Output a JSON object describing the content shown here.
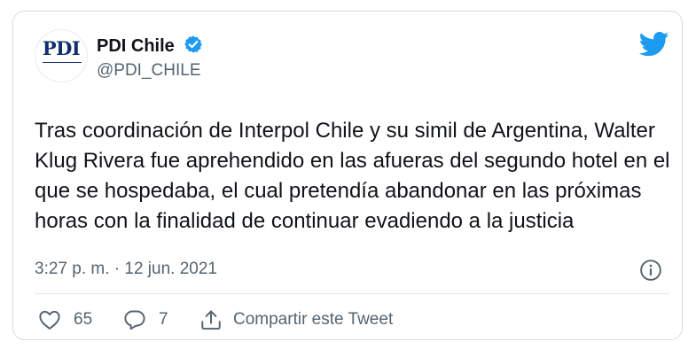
{
  "account": {
    "display_name": "PDI Chile",
    "handle": "@PDI_CHILE",
    "avatar_text": "PDI",
    "verified": true
  },
  "tweet": {
    "text": "Tras coordinación de Interpol Chile y su simil de Argentina, Walter Klug Rivera fue aprehendido en las afueras del segundo hotel en el que se hospedaba, el cual pretendía abandonar en las próximas horas con la finalidad de continuar evadiendo a la justicia",
    "timestamp": "3:27 p. m. · 12 jun. 2021"
  },
  "actions": {
    "like_count": "65",
    "reply_count": "7",
    "share_label": "Compartir este Tweet"
  },
  "icons": {
    "brand": "twitter-bird-icon",
    "verified": "verified-badge-icon",
    "info": "info-icon",
    "like": "heart-icon",
    "reply": "speech-bubble-icon",
    "share": "share-icon"
  },
  "colors": {
    "brand_blue": "#1d9bf0",
    "text": "#0f1419",
    "secondary_text": "#536471"
  }
}
